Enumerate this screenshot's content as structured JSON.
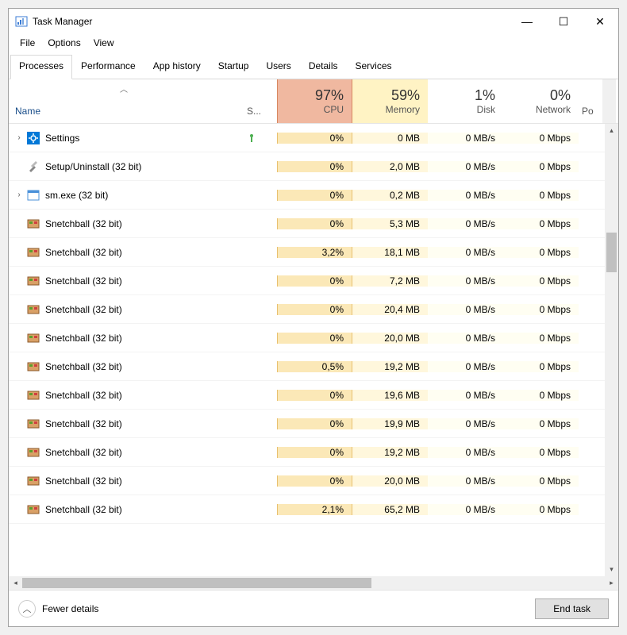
{
  "window": {
    "title": "Task Manager",
    "controls": {
      "min": "—",
      "max": "☐",
      "close": "✕"
    }
  },
  "menu": {
    "items": [
      "File",
      "Options",
      "View"
    ]
  },
  "tabs": {
    "items": [
      "Processes",
      "Performance",
      "App history",
      "Startup",
      "Users",
      "Details",
      "Services"
    ],
    "active": 0
  },
  "columns": {
    "name": "Name",
    "status": "S...",
    "cpu": {
      "pct": "97%",
      "label": "CPU"
    },
    "memory": {
      "pct": "59%",
      "label": "Memory"
    },
    "disk": {
      "pct": "1%",
      "label": "Disk"
    },
    "network": {
      "pct": "0%",
      "label": "Network"
    },
    "power": "Po"
  },
  "processes": [
    {
      "expandable": true,
      "icon": "settings",
      "name": "Settings",
      "status_icon": true,
      "cpu": "0%",
      "memory": "0 MB",
      "disk": "0 MB/s",
      "network": "0 Mbps"
    },
    {
      "expandable": false,
      "icon": "tools",
      "name": "Setup/Uninstall (32 bit)",
      "cpu": "0%",
      "memory": "2,0 MB",
      "disk": "0 MB/s",
      "network": "0 Mbps"
    },
    {
      "expandable": true,
      "icon": "window",
      "name": "sm.exe (32 bit)",
      "cpu": "0%",
      "memory": "0,2 MB",
      "disk": "0 MB/s",
      "network": "0 Mbps"
    },
    {
      "expandable": false,
      "icon": "game",
      "name": "Snetchball (32 bit)",
      "cpu": "0%",
      "memory": "5,3 MB",
      "disk": "0 MB/s",
      "network": "0 Mbps"
    },
    {
      "expandable": false,
      "icon": "game",
      "name": "Snetchball (32 bit)",
      "cpu": "3,2%",
      "memory": "18,1 MB",
      "disk": "0 MB/s",
      "network": "0 Mbps"
    },
    {
      "expandable": false,
      "icon": "game",
      "name": "Snetchball (32 bit)",
      "cpu": "0%",
      "memory": "7,2 MB",
      "disk": "0 MB/s",
      "network": "0 Mbps"
    },
    {
      "expandable": false,
      "icon": "game",
      "name": "Snetchball (32 bit)",
      "cpu": "0%",
      "memory": "20,4 MB",
      "disk": "0 MB/s",
      "network": "0 Mbps"
    },
    {
      "expandable": false,
      "icon": "game",
      "name": "Snetchball (32 bit)",
      "cpu": "0%",
      "memory": "20,0 MB",
      "disk": "0 MB/s",
      "network": "0 Mbps"
    },
    {
      "expandable": false,
      "icon": "game",
      "name": "Snetchball (32 bit)",
      "cpu": "0,5%",
      "memory": "19,2 MB",
      "disk": "0 MB/s",
      "network": "0 Mbps"
    },
    {
      "expandable": false,
      "icon": "game",
      "name": "Snetchball (32 bit)",
      "cpu": "0%",
      "memory": "19,6 MB",
      "disk": "0 MB/s",
      "network": "0 Mbps"
    },
    {
      "expandable": false,
      "icon": "game",
      "name": "Snetchball (32 bit)",
      "cpu": "0%",
      "memory": "19,9 MB",
      "disk": "0 MB/s",
      "network": "0 Mbps"
    },
    {
      "expandable": false,
      "icon": "game",
      "name": "Snetchball (32 bit)",
      "cpu": "0%",
      "memory": "19,2 MB",
      "disk": "0 MB/s",
      "network": "0 Mbps"
    },
    {
      "expandable": false,
      "icon": "game",
      "name": "Snetchball (32 bit)",
      "cpu": "0%",
      "memory": "20,0 MB",
      "disk": "0 MB/s",
      "network": "0 Mbps"
    },
    {
      "expandable": false,
      "icon": "game",
      "name": "Snetchball (32 bit)",
      "cpu": "2,1%",
      "memory": "65,2 MB",
      "disk": "0 MB/s",
      "network": "0 Mbps"
    }
  ],
  "footer": {
    "fewer_details": "Fewer details",
    "end_task": "End task"
  }
}
